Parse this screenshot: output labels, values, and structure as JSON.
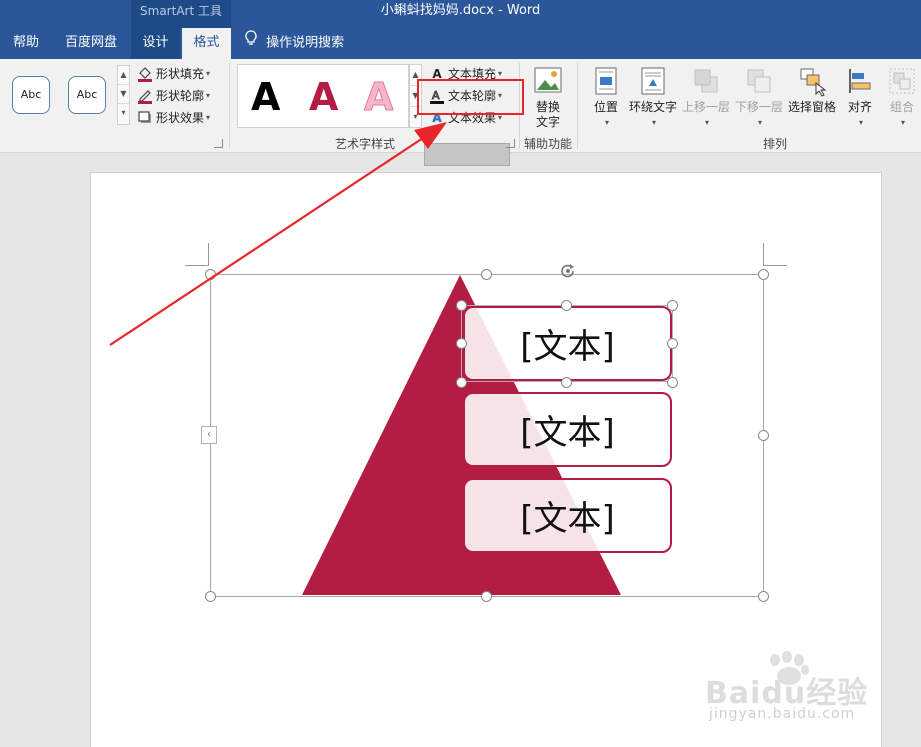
{
  "titlebar": {
    "context_group": "SmartArt 工具",
    "doc_title": "小蝌蚪找妈妈.docx  -  Word"
  },
  "tabs": [
    {
      "label": "帮助"
    },
    {
      "label": "百度网盘"
    },
    {
      "label": "设计"
    },
    {
      "label": "格式"
    }
  ],
  "tell_me": {
    "label": "操作说明搜索",
    "icon": "lightbulb-icon"
  },
  "shape_styles": {
    "thumbs": [
      "Abc",
      "Abc"
    ],
    "fill": "形状填充",
    "outline": "形状轮廓",
    "effects": "形状效果"
  },
  "wordart": {
    "group_label": "艺术字样式",
    "samples": [
      "A",
      "A",
      "A"
    ],
    "text_fill": "文本填充",
    "text_outline": "文本轮廓",
    "text_effects": "文本效果"
  },
  "accessibility": {
    "group_label": "辅助功能",
    "alt_text_line1": "替换",
    "alt_text_line2": "文字"
  },
  "arrange": {
    "group_label": "排列",
    "position": "位置",
    "wrap_text": "环绕文字",
    "bring_forward": "上移一层",
    "send_backward": "下移一层",
    "selection_pane": "选择窗格",
    "align": "对齐",
    "group": "组合"
  },
  "diagram": {
    "items": [
      "[文本]",
      "[文本]",
      "[文本]"
    ]
  },
  "watermark": {
    "brand": "Baidu经验",
    "url": "jingyan.baidu.com"
  },
  "colors": {
    "title_bar": "#2b579a",
    "accent_crimson": "#b31d44",
    "highlight_red": "#e8262a"
  }
}
